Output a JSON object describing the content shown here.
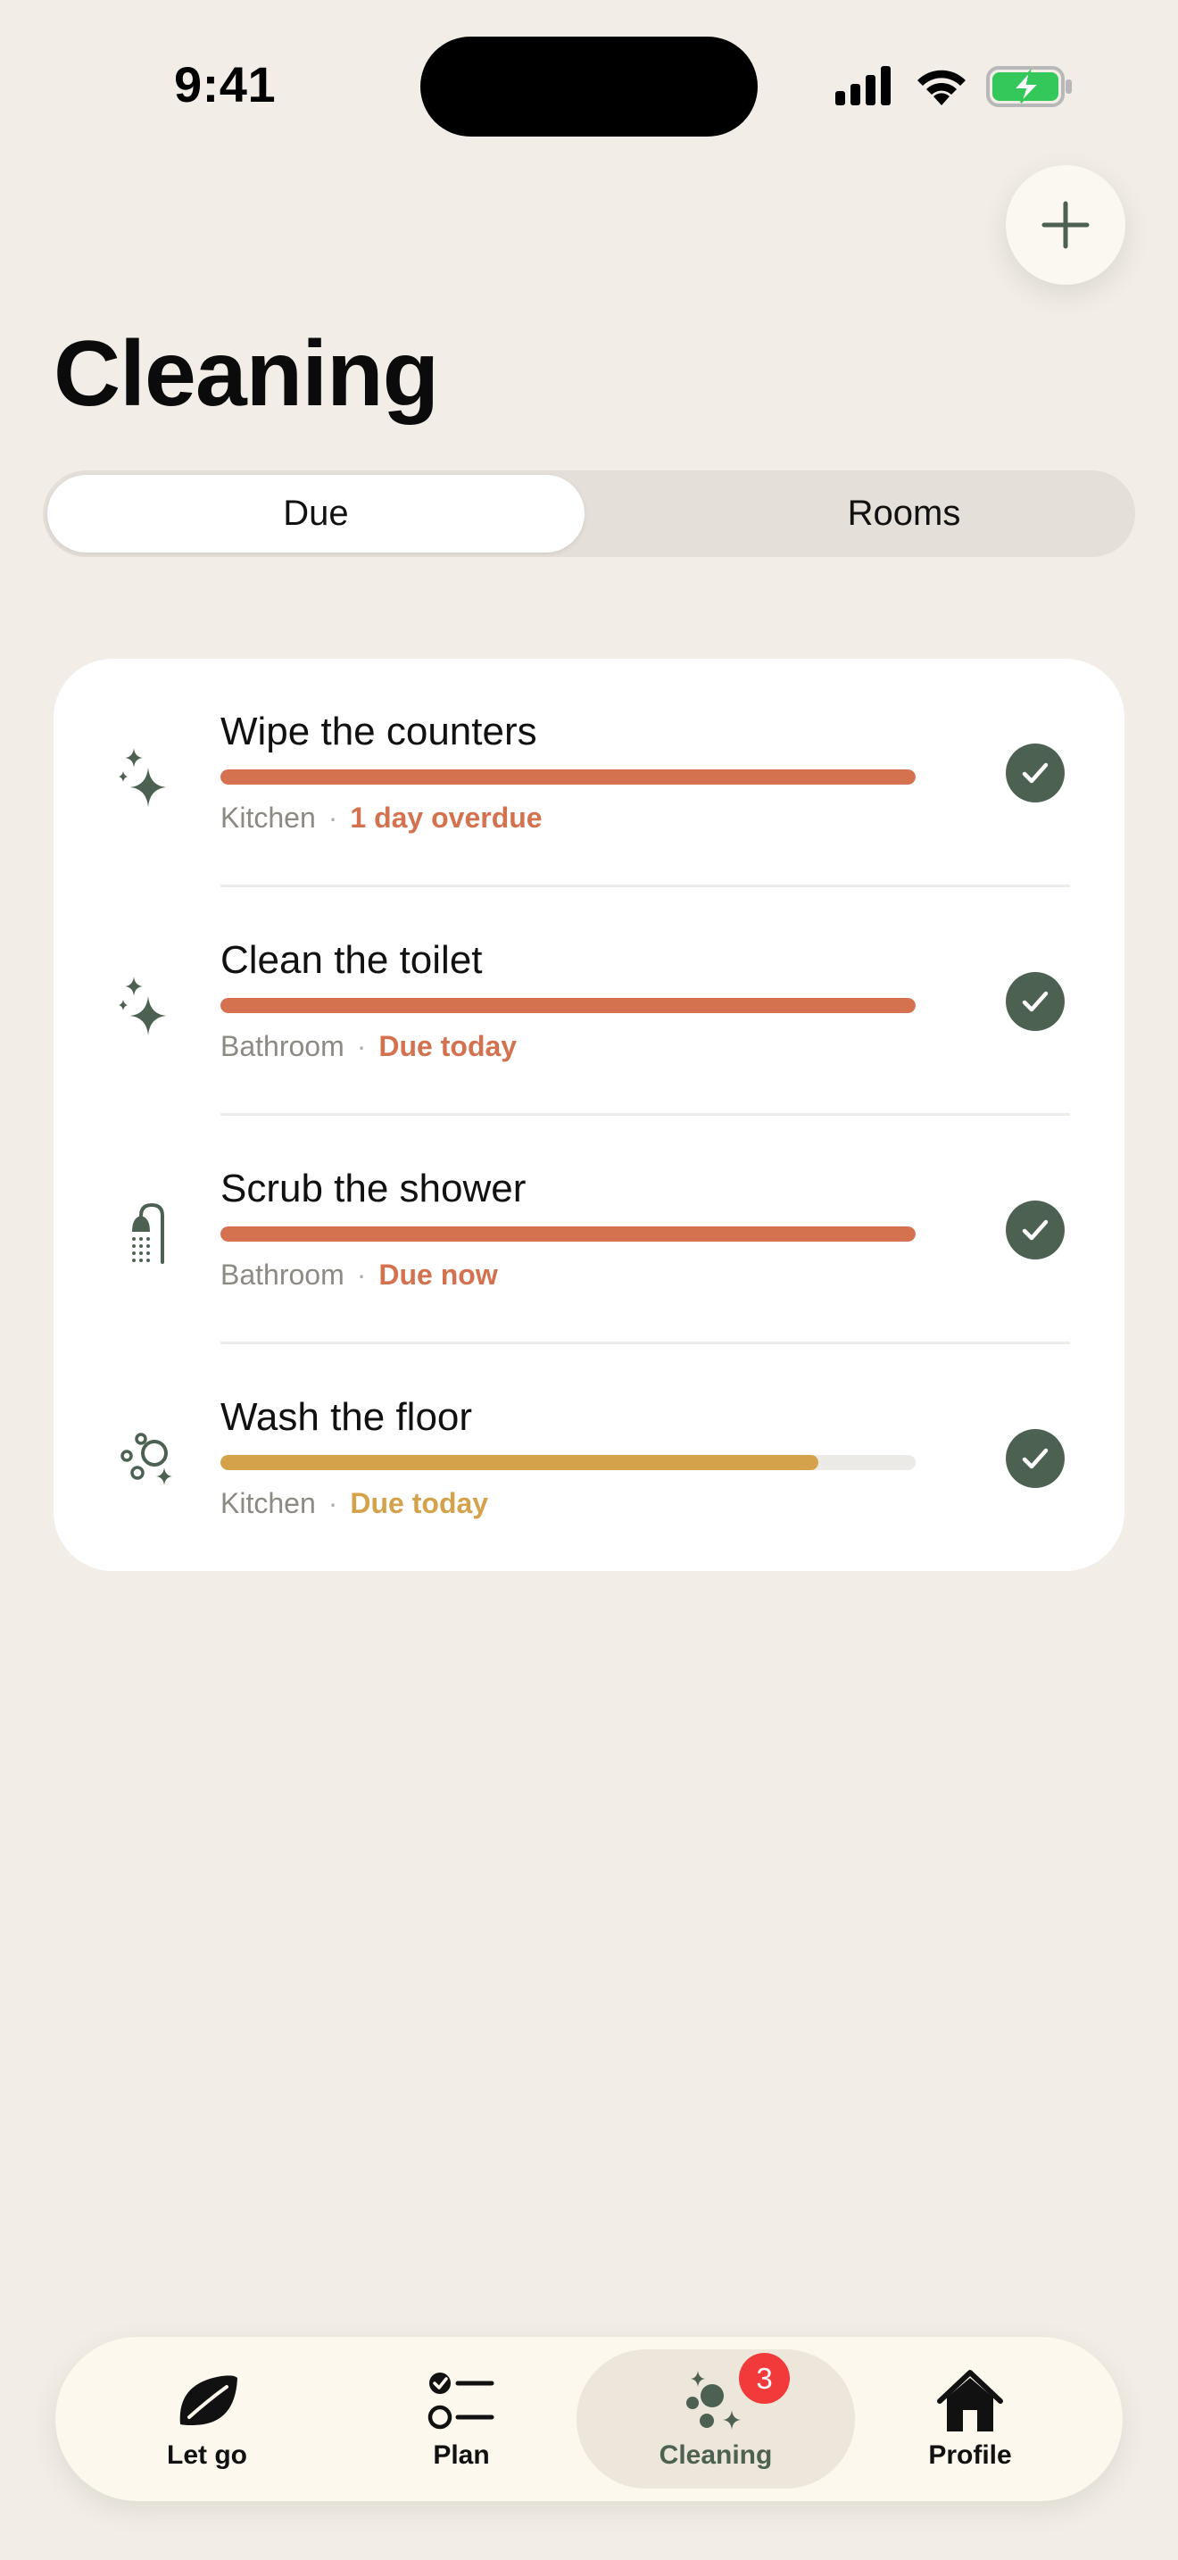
{
  "status_bar": {
    "time": "9:41"
  },
  "header": {
    "title": "Cleaning",
    "add_icon": "plus-icon"
  },
  "segments": {
    "active": "Due",
    "inactive": "Rooms"
  },
  "colors": {
    "accent_green": "#4d6152",
    "overdue_orange": "#d4724f",
    "soon_gold": "#d4a24a",
    "badge_red": "#f23a3a",
    "background": "#f2eee7"
  },
  "tasks": [
    {
      "title": "Wipe the counters",
      "room": "Kitchen",
      "due": "1 day overdue",
      "icon": "sparkles-icon",
      "progress": 1.0,
      "status_color": "#d4724f"
    },
    {
      "title": "Clean the toilet",
      "room": "Bathroom",
      "due": "Due today",
      "icon": "sparkles-icon",
      "progress": 1.0,
      "status_color": "#d4724f"
    },
    {
      "title": "Scrub the shower",
      "room": "Bathroom",
      "due": "Due now",
      "icon": "shower-icon",
      "progress": 1.0,
      "status_color": "#d4724f"
    },
    {
      "title": "Wash the floor",
      "room": "Kitchen",
      "due": "Due today",
      "icon": "bubbles-icon",
      "progress": 0.86,
      "status_color": "#d4a24a"
    }
  ],
  "tab_bar": {
    "items": [
      {
        "label": "Let go",
        "icon": "leaf-icon"
      },
      {
        "label": "Plan",
        "icon": "checklist-icon"
      },
      {
        "label": "Cleaning",
        "icon": "cleaning-sparkles-icon",
        "selected": true,
        "badge": "3"
      },
      {
        "label": "Profile",
        "icon": "house-icon"
      }
    ]
  }
}
